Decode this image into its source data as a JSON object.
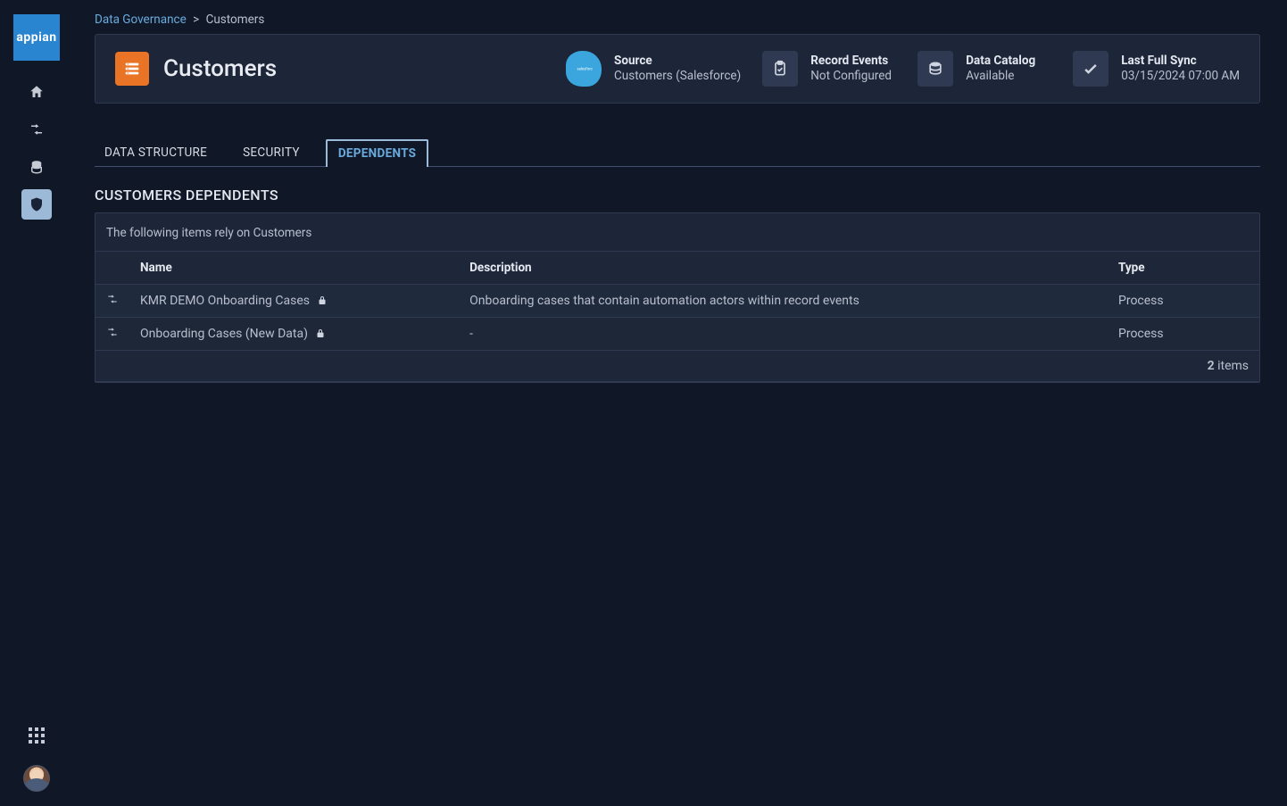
{
  "logo_text": "appian",
  "breadcrumb": {
    "root": "Data Governance",
    "current": "Customers"
  },
  "header": {
    "title": "Customers",
    "meta": {
      "source": {
        "label": "Source",
        "value": "Customers (Salesforce)"
      },
      "record_events": {
        "label": "Record Events",
        "value": "Not Configured"
      },
      "data_catalog": {
        "label": "Data Catalog",
        "value": "Available"
      },
      "last_sync": {
        "label": "Last Full Sync",
        "value": "03/15/2024 07:00 AM"
      }
    }
  },
  "tabs": {
    "data_structure": "DATA STRUCTURE",
    "security": "SECURITY",
    "dependents": "DEPENDENTS"
  },
  "section": {
    "title": "CUSTOMERS DEPENDENTS",
    "caption": "The following items rely on Customers"
  },
  "columns": {
    "name": "Name",
    "description": "Description",
    "type": "Type"
  },
  "rows": [
    {
      "name": "KMR DEMO Onboarding Cases",
      "locked": true,
      "description": "Onboarding cases that contain automation actors within record events",
      "type": "Process"
    },
    {
      "name": "Onboarding Cases (New Data)",
      "locked": true,
      "description": "-",
      "type": "Process"
    }
  ],
  "footer": {
    "count": "2",
    "items_label": " items"
  }
}
